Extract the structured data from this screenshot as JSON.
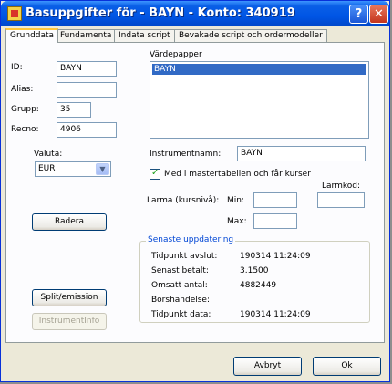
{
  "window": {
    "title": "Basuppgifter för - BAYN - Konto: 340919",
    "help_label": "?",
    "close_label": "✕"
  },
  "tabs": [
    {
      "label": "Grunddata",
      "active": true
    },
    {
      "label": "Fundamenta",
      "active": false
    },
    {
      "label": "Indata script",
      "active": false
    },
    {
      "label": "Bevakade script och ordermodeller",
      "active": false
    }
  ],
  "form": {
    "id_label": "ID:",
    "id_value": "BAYN",
    "alias_label": "Alias:",
    "alias_value": "",
    "grupp_label": "Grupp:",
    "grupp_value": "35",
    "recno_label": "Recno:",
    "recno_value": "4906",
    "valuta_label": "Valuta:",
    "valuta_value": "EUR",
    "radera_label": "Radera",
    "split_label": "Split/emission",
    "instrumentinfo_label": "InstrumentInfo"
  },
  "vardepapper": {
    "label": "Värdepapper",
    "items": [
      "BAYN"
    ]
  },
  "instrument": {
    "name_label": "Instrumentnamn:",
    "name_value": "BAYN",
    "master_checkbox_label": "Med i mastertabellen och får kurser",
    "master_checked": true,
    "larm_label": "Larma (kursnivå):",
    "min_label": "Min:",
    "min_value": "",
    "max_label": "Max:",
    "max_value": "",
    "larmkod_label": "Larmkod:",
    "larmkod_value": ""
  },
  "senaste": {
    "title": "Senaste uppdatering",
    "rows": [
      {
        "label": "Tidpunkt avslut:",
        "value": "190314 11:24:09"
      },
      {
        "label": "Senast betalt:",
        "value": "3.1500"
      },
      {
        "label": "Omsatt antal:",
        "value": "4882449"
      },
      {
        "label": "Börshändelse:",
        "value": ""
      },
      {
        "label": "Tidpunkt data:",
        "value": "190314 11:24:09"
      }
    ]
  },
  "footer": {
    "cancel_label": "Avbryt",
    "ok_label": "Ok"
  }
}
